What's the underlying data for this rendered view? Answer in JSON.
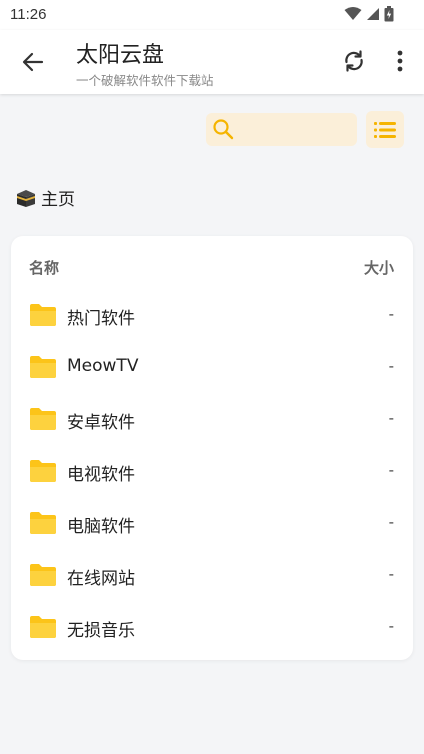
{
  "status_bar": {
    "time": "11:26"
  },
  "app_bar": {
    "title": "太阳云盘",
    "subtitle": "一个破解软件软件下载站"
  },
  "search": {
    "placeholder": ""
  },
  "breadcrumb": {
    "label": "主页",
    "icon": "kaaba-emoji-icon"
  },
  "file_list": {
    "column_name": "名称",
    "column_size": "大小",
    "items": [
      {
        "name": "热门软件",
        "size": "-"
      },
      {
        "name": "MeowTV",
        "size": "-"
      },
      {
        "name": "安卓软件",
        "size": "-"
      },
      {
        "name": "电视软件",
        "size": "-"
      },
      {
        "name": "电脑软件",
        "size": "-"
      },
      {
        "name": "在线网站",
        "size": "-"
      },
      {
        "name": "无损音乐",
        "size": "-"
      }
    ]
  },
  "colors": {
    "accent": "#f5b400",
    "accent_bg": "#fbefd9",
    "folder": "#fcc419",
    "background": "#f4f5f7"
  }
}
